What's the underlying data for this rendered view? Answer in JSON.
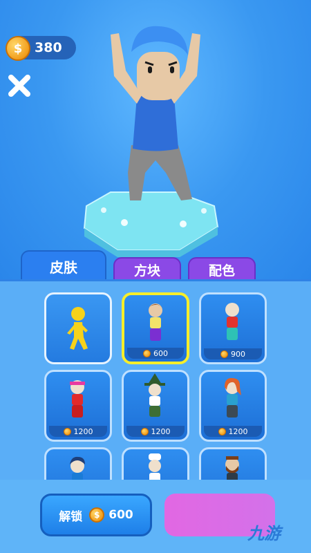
{
  "hud": {
    "coins": "380",
    "coin_symbol": "$"
  },
  "tabs": [
    {
      "label": "皮肤",
      "active": true
    },
    {
      "label": "方块",
      "active": false
    },
    {
      "label": "配色",
      "active": false
    }
  ],
  "items": [
    {
      "name": "yellow-runner",
      "price": "",
      "selected": false,
      "owned": true
    },
    {
      "name": "brown-hair-runner",
      "price": "600",
      "selected": true,
      "owned": false
    },
    {
      "name": "bald-red-runner",
      "price": "900",
      "selected": false,
      "owned": false
    },
    {
      "name": "headband-runner",
      "price": "1200",
      "selected": false,
      "owned": false
    },
    {
      "name": "witch-runner",
      "price": "1200",
      "selected": false,
      "owned": false
    },
    {
      "name": "redhead-runner",
      "price": "1200",
      "selected": false,
      "owned": false
    },
    {
      "name": "blue-hair-runner",
      "price": "",
      "selected": false,
      "owned": false
    },
    {
      "name": "chef-runner",
      "price": "",
      "selected": false,
      "owned": false
    },
    {
      "name": "bearded-runner",
      "price": "",
      "selected": false,
      "owned": false
    }
  ],
  "unlock": {
    "label": "解锁",
    "price": "600"
  },
  "watermark": "九游",
  "colors": {
    "tab_active": "#2b7ff0",
    "tab_inactive": "#8b49e6",
    "selected_border": "#f7ee2a",
    "ad_button": "#e86ae8"
  }
}
